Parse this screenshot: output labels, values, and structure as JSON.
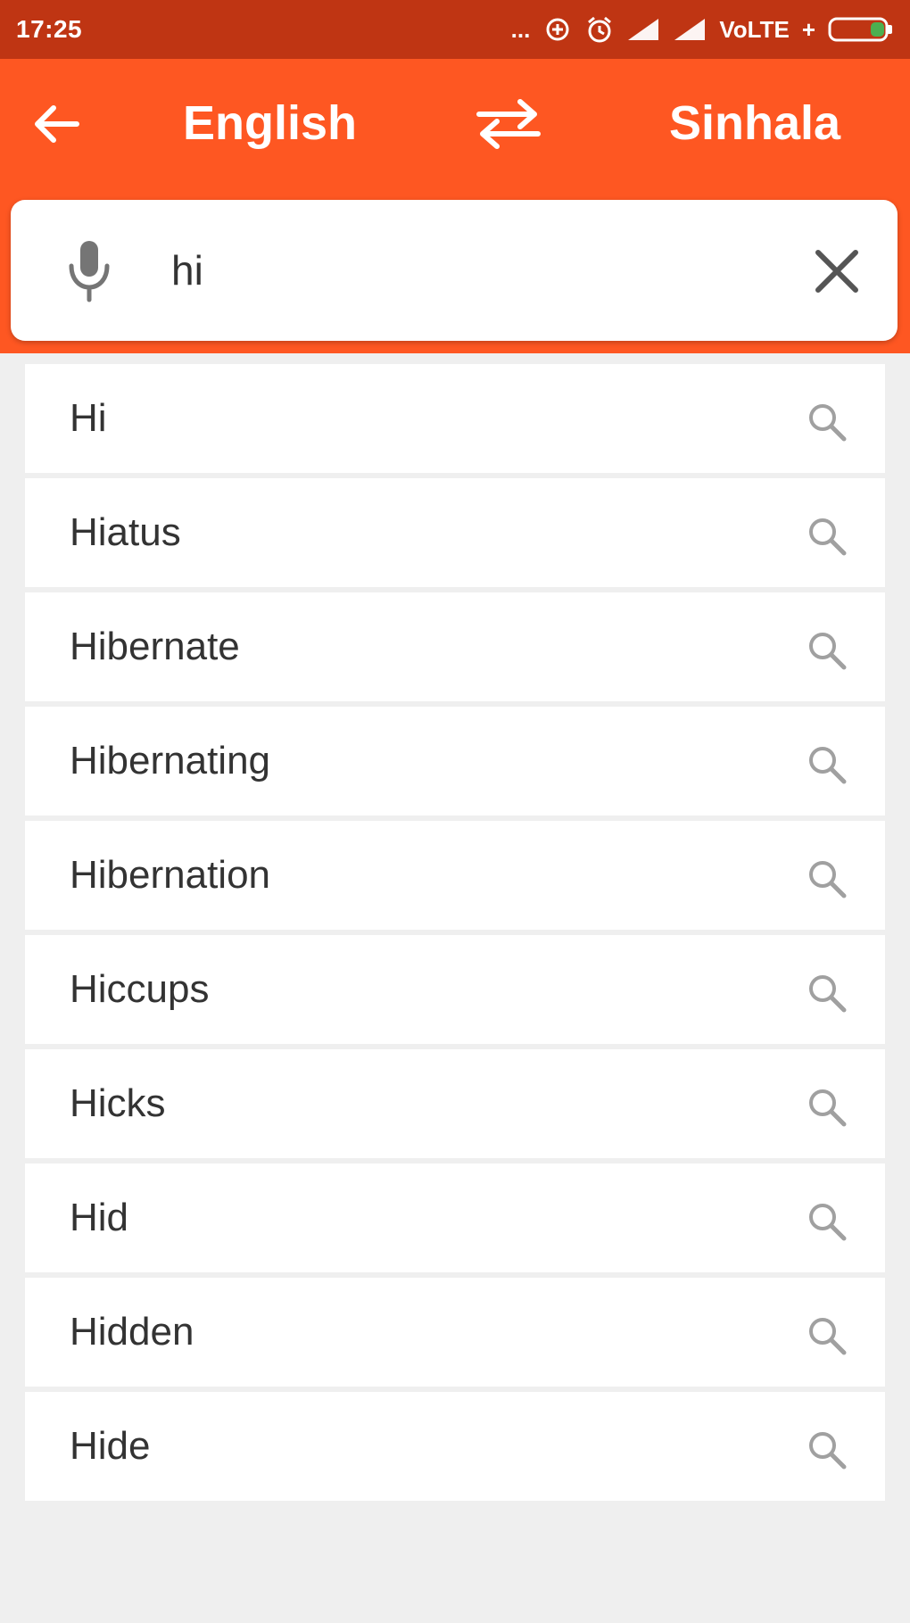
{
  "status_bar": {
    "time": "17:25",
    "dots": "...",
    "network": "VoLTE",
    "charging": "+"
  },
  "toolbar": {
    "source_language": "English",
    "target_language": "Sinhala"
  },
  "search": {
    "value": "hi"
  },
  "suggestions": [
    {
      "word": "Hi"
    },
    {
      "word": "Hiatus"
    },
    {
      "word": "Hibernate"
    },
    {
      "word": "Hibernating"
    },
    {
      "word": "Hibernation"
    },
    {
      "word": "Hiccups"
    },
    {
      "word": "Hicks"
    },
    {
      "word": "Hid"
    },
    {
      "word": "Hidden"
    },
    {
      "word": "Hide"
    }
  ],
  "colors": {
    "status_bar": "#bf3513",
    "app_bar": "#fe5722",
    "background": "#efefef",
    "battery_fill": "#4caf50"
  },
  "icons": {
    "back": "arrow-left-icon",
    "swap": "swap-arrows-icon",
    "mic": "microphone-icon",
    "clear": "close-icon",
    "suggestion": "search-icon"
  }
}
